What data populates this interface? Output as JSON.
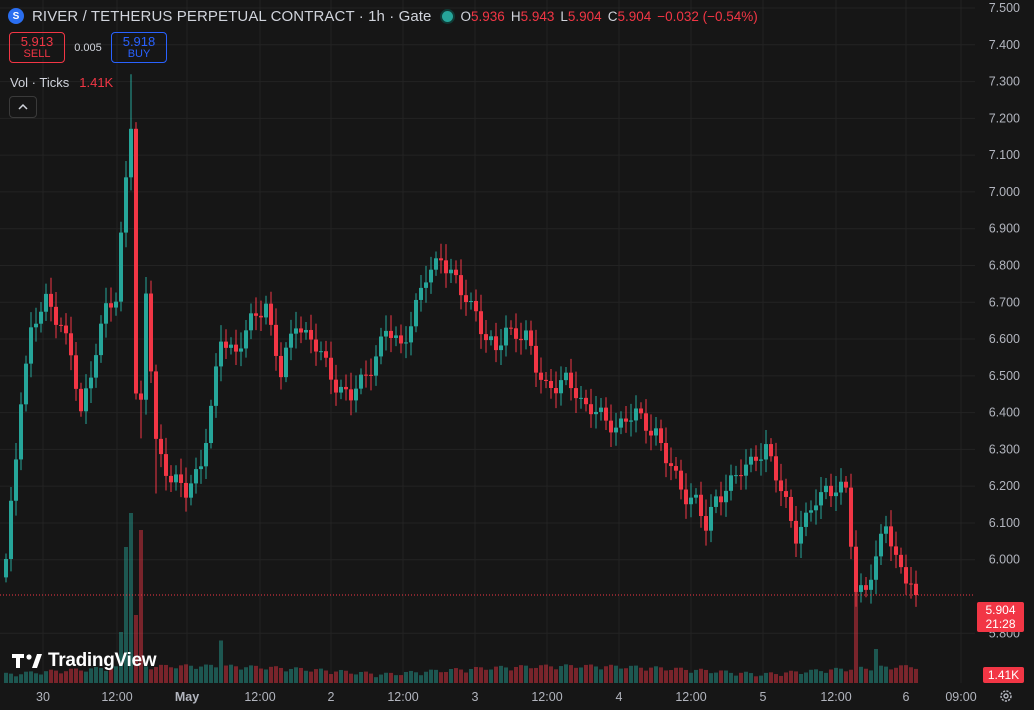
{
  "header": {
    "symbol_logo": "S",
    "title": "RIVER / TETHERUS PERPETUAL CONTRACT · 1h · Gate",
    "status_color": "#26a69a",
    "ohlc": {
      "o_label": "O",
      "o": "5.936",
      "h_label": "H",
      "h": "5.943",
      "l_label": "L",
      "l": "5.904",
      "c_label": "C",
      "c": "5.904",
      "change": "−0.032 (−0.54%)"
    }
  },
  "trade": {
    "sell_price": "5.913",
    "sell_label": "SELL",
    "spread": "0.005",
    "buy_price": "5.918",
    "buy_label": "BUY"
  },
  "volume_legend": {
    "label": "Vol · Ticks",
    "value": "1.41K"
  },
  "logo_text": "TradingView",
  "last_price": {
    "price": "5.904",
    "countdown": "21:28"
  },
  "last_volume": "1.41K",
  "colors": {
    "up": "#26a69a",
    "down": "#f23645",
    "background": "#161616",
    "grid": "#232323"
  },
  "icons": {
    "collapse": "chevron-up-icon",
    "settings": "gear-icon",
    "logo": "tradingview-logo-icon"
  },
  "chart_data": {
    "type": "candlestick",
    "interval": "1h",
    "price_axis": {
      "min": 5.76,
      "max": 7.5,
      "ticks": [
        "7.500",
        "7.400",
        "7.300",
        "7.200",
        "7.100",
        "7.000",
        "6.900",
        "6.800",
        "6.700",
        "6.600",
        "6.500",
        "6.400",
        "6.300",
        "6.200",
        "6.100",
        "6.000",
        "5.800"
      ]
    },
    "time_axis": {
      "labels": [
        "30",
        "12:00",
        "May",
        "12:00",
        "2",
        "12:00",
        "3",
        "12:00",
        "4",
        "12:00",
        "5",
        "12:00",
        "6",
        "09:00"
      ]
    },
    "last_price_line": 5.904,
    "keypoints": [
      [
        0,
        5.99
      ],
      [
        2,
        6.28
      ],
      [
        3,
        6.45
      ],
      [
        5,
        6.62
      ],
      [
        8,
        6.7
      ],
      [
        11,
        6.65
      ],
      [
        13,
        6.55
      ],
      [
        15,
        6.39
      ],
      [
        18,
        6.58
      ],
      [
        20,
        6.68
      ],
      [
        22,
        6.7
      ],
      [
        24,
        7.05
      ],
      [
        25,
        7.2
      ],
      [
        26,
        6.45
      ],
      [
        27,
        6.41
      ],
      [
        28,
        6.72
      ],
      [
        30,
        6.32
      ],
      [
        33,
        6.22
      ],
      [
        36,
        6.18
      ],
      [
        39,
        6.27
      ],
      [
        41,
        6.4
      ],
      [
        43,
        6.6
      ],
      [
        46,
        6.57
      ],
      [
        49,
        6.64
      ],
      [
        52,
        6.7
      ],
      [
        55,
        6.5
      ],
      [
        58,
        6.65
      ],
      [
        61,
        6.6
      ],
      [
        63,
        6.55
      ],
      [
        66,
        6.48
      ],
      [
        69,
        6.44
      ],
      [
        71,
        6.48
      ],
      [
        73,
        6.53
      ],
      [
        76,
        6.62
      ],
      [
        79,
        6.58
      ],
      [
        82,
        6.69
      ],
      [
        84,
        6.76
      ],
      [
        87,
        6.83
      ],
      [
        89,
        6.78
      ],
      [
        91,
        6.72
      ],
      [
        94,
        6.68
      ],
      [
        96,
        6.6
      ],
      [
        98,
        6.56
      ],
      [
        100,
        6.63
      ],
      [
        102,
        6.62
      ],
      [
        104,
        6.6
      ],
      [
        106,
        6.52
      ],
      [
        108,
        6.48
      ],
      [
        110,
        6.47
      ],
      [
        112,
        6.48
      ],
      [
        114,
        6.46
      ],
      [
        116,
        6.42
      ],
      [
        118,
        6.4
      ],
      [
        120,
        6.37
      ],
      [
        122,
        6.37
      ],
      [
        124,
        6.38
      ],
      [
        126,
        6.39
      ],
      [
        128,
        6.37
      ],
      [
        130,
        6.35
      ],
      [
        132,
        6.27
      ],
      [
        134,
        6.22
      ],
      [
        136,
        6.18
      ],
      [
        138,
        6.16
      ],
      [
        140,
        6.08
      ],
      [
        142,
        6.17
      ],
      [
        144,
        6.2
      ],
      [
        146,
        6.22
      ],
      [
        148,
        6.25
      ],
      [
        150,
        6.29
      ],
      [
        152,
        6.3
      ],
      [
        154,
        6.22
      ],
      [
        156,
        6.16
      ],
      [
        158,
        6.07
      ],
      [
        160,
        6.1
      ],
      [
        162,
        6.16
      ],
      [
        164,
        6.2
      ],
      [
        166,
        6.19
      ],
      [
        168,
        6.18
      ],
      [
        170,
        5.92
      ],
      [
        172,
        5.93
      ],
      [
        174,
        5.99
      ],
      [
        176,
        6.1
      ],
      [
        178,
        6.01
      ],
      [
        180,
        5.95
      ],
      [
        182,
        5.904
      ]
    ],
    "volume_spikes": [
      [
        23,
        0.3
      ],
      [
        24,
        0.8
      ],
      [
        25,
        1.0
      ],
      [
        26,
        0.4
      ],
      [
        27,
        0.9
      ],
      [
        43,
        0.25
      ],
      [
        170,
        0.6
      ],
      [
        174,
        0.2
      ]
    ]
  }
}
